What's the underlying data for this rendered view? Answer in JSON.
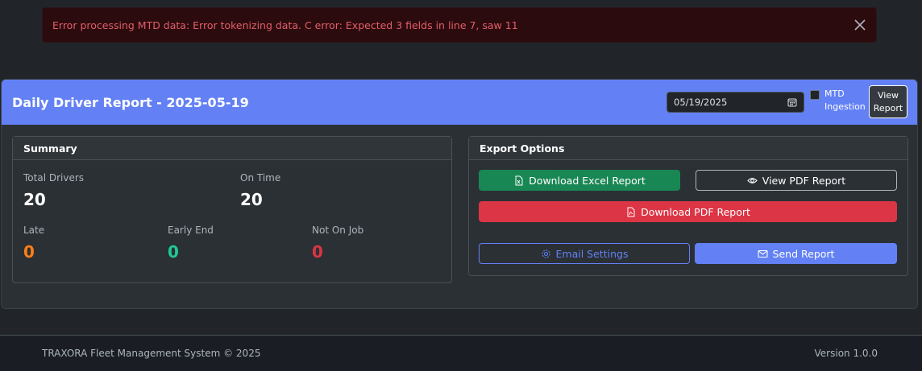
{
  "alert": {
    "message": "Error processing MTD data: Error tokenizing data. C error: Expected 3 fields in line 7, saw 11"
  },
  "header": {
    "title": "Daily Driver Report - 2025-05-19",
    "date_value": "05/19/2025",
    "mtd_label": "MTD Ingestion",
    "mtd_checked": false,
    "view_report_label": "View Report"
  },
  "summary": {
    "title": "Summary",
    "total_drivers_label": "Total Drivers",
    "total_drivers_value": "20",
    "on_time_label": "On Time",
    "on_time_value": "20",
    "late_label": "Late",
    "late_value": "0",
    "early_end_label": "Early End",
    "early_end_value": "0",
    "not_on_job_label": "Not On Job",
    "not_on_job_value": "0"
  },
  "export": {
    "title": "Export Options",
    "download_excel_label": "Download Excel Report",
    "view_pdf_label": "View PDF Report",
    "download_pdf_label": "Download PDF Report",
    "email_settings_label": "Email Settings",
    "send_report_label": "Send Report"
  },
  "footer": {
    "copyright": "TRAXORA Fleet Management System © 2025",
    "version": "Version 1.0.0"
  },
  "colors": {
    "accent": "#6381f5",
    "excel": "#198754",
    "pdf": "#dc3545",
    "late": "#fd7e14",
    "early_end": "#20c997",
    "not_on_job": "#dc3545"
  }
}
